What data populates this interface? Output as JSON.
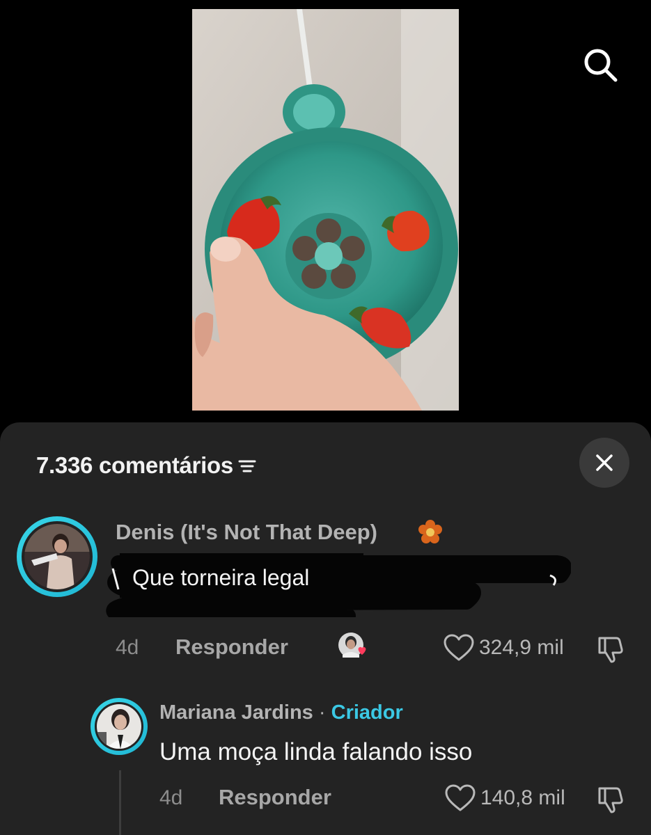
{
  "video": {
    "description_icon": "video-thumbnail-strawberries-colander"
  },
  "search": {
    "icon": "search-icon"
  },
  "comments": {
    "count_label": "7.336 comentários",
    "sort_icon": "sort-icon",
    "close_icon": "close-icon",
    "items": [
      {
        "author": "Denis (It's Not That Deep)",
        "badge_icon": "flower-icon",
        "text": "Que torneira legal",
        "time": "4d",
        "reply_label": "Responder",
        "likes": "324,9 mil",
        "liked_by_creator": true
      }
    ],
    "reply": {
      "author": "Mariana Jardins",
      "separator": "·",
      "badge": "Criador",
      "text": "Uma moça linda falando isso",
      "time": "4d",
      "reply_label": "Responder",
      "likes": "140,8 mil"
    }
  },
  "colors": {
    "accent": "#3bc8e4",
    "sheet_bg": "#232323",
    "page_bg": "#000000"
  }
}
